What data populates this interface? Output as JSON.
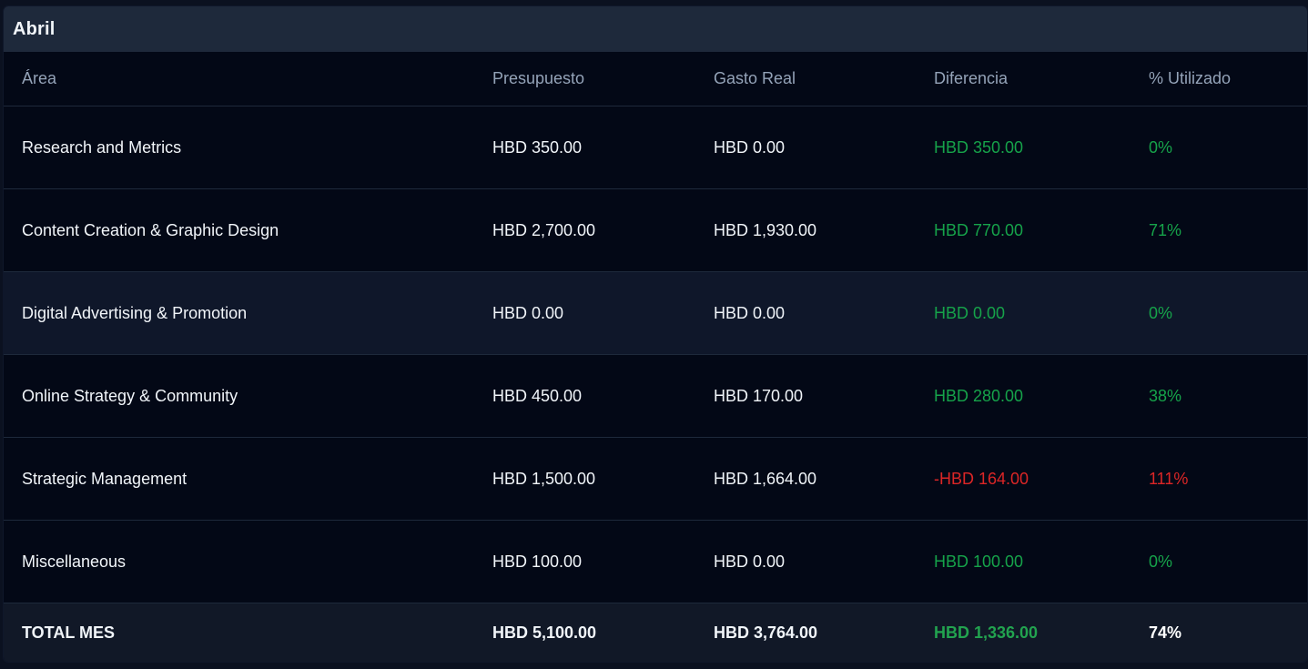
{
  "month": {
    "title": "Abril"
  },
  "columns": {
    "area": "Área",
    "budget": "Presupuesto",
    "actual": "Gasto Real",
    "difference": "Diferencia",
    "used": "% Utilizado"
  },
  "rows": [
    {
      "area": "Research and Metrics",
      "budget": "HBD 350.00",
      "actual": "HBD 0.00",
      "difference": "HBD 350.00",
      "used": "0%",
      "status": "positive"
    },
    {
      "area": "Content Creation & Graphic Design",
      "budget": "HBD 2,700.00",
      "actual": "HBD 1,930.00",
      "difference": "HBD 770.00",
      "used": "71%",
      "status": "positive"
    },
    {
      "area": "Digital Advertising & Promotion",
      "budget": "HBD 0.00",
      "actual": "HBD 0.00",
      "difference": "HBD 0.00",
      "used": "0%",
      "status": "positive"
    },
    {
      "area": "Online Strategy & Community",
      "budget": "HBD 450.00",
      "actual": "HBD 170.00",
      "difference": "HBD 280.00",
      "used": "38%",
      "status": "positive"
    },
    {
      "area": "Strategic Management",
      "budget": "HBD 1,500.00",
      "actual": "HBD 1,664.00",
      "difference": "-HBD 164.00",
      "used": "111%",
      "status": "negative"
    },
    {
      "area": "Miscellaneous",
      "budget": "HBD 100.00",
      "actual": "HBD 0.00",
      "difference": "HBD 100.00",
      "used": "0%",
      "status": "positive"
    }
  ],
  "total": {
    "label": "TOTAL MES",
    "budget": "HBD 5,100.00",
    "actual": "HBD 3,764.00",
    "difference": "HBD 1,336.00",
    "used": "74%"
  },
  "colors": {
    "positive": "#16a34a",
    "negative": "#dc2626",
    "header_bg": "#1e293b",
    "table_bg": "#030816"
  }
}
